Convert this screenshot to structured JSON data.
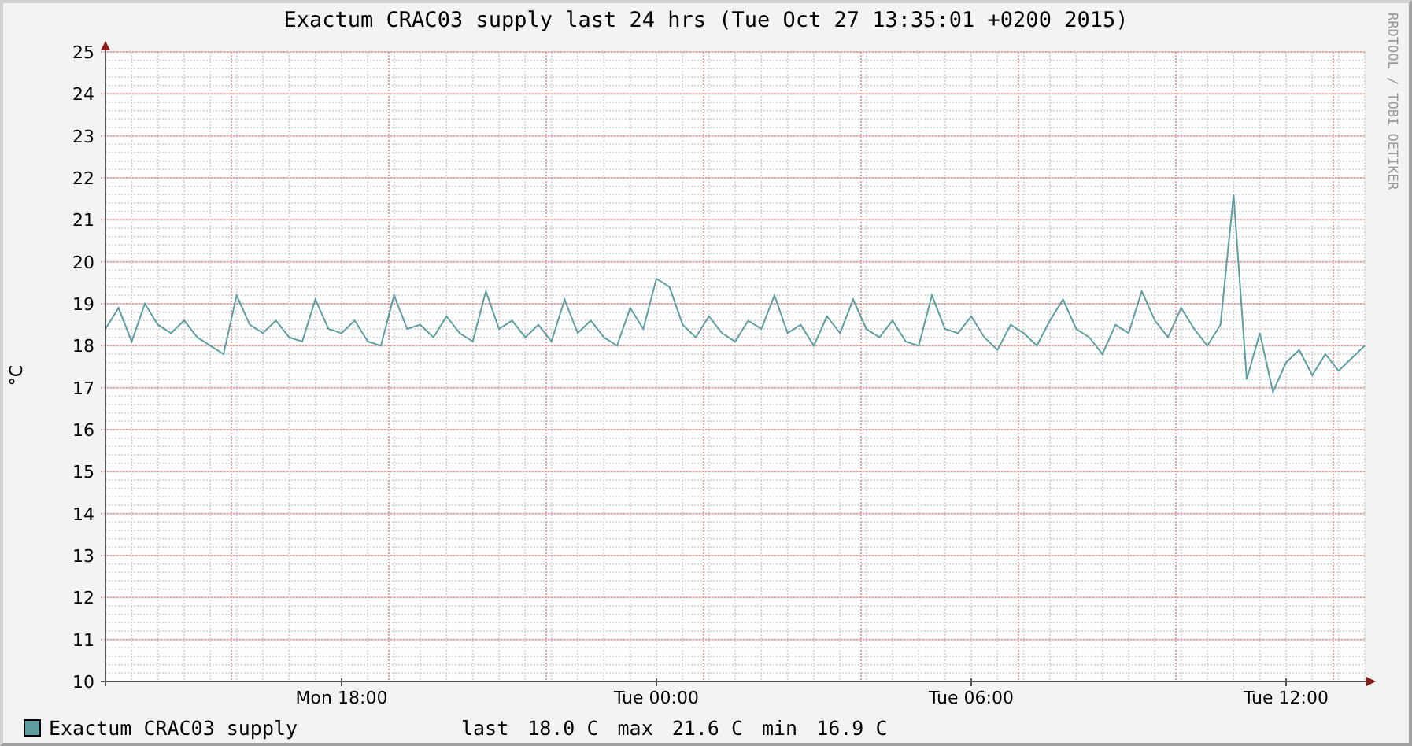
{
  "graph": {
    "credit": "RRDTOOL / TOBI OETIKER",
    "chart_data": {
      "type": "line",
      "title": "Exactum CRAC03 supply last 24 hrs (Tue Oct 27 13:35:01 +0200 2015)",
      "ylabel": "°C",
      "grid": true,
      "ylim": [
        10,
        25
      ],
      "yticks": [
        10,
        11,
        12,
        13,
        14,
        15,
        16,
        17,
        18,
        19,
        20,
        21,
        22,
        23,
        24,
        25
      ],
      "categories": [
        null,
        null,
        null,
        null,
        null,
        null,
        null,
        null,
        null,
        null,
        null,
        null,
        null,
        null,
        null,
        null,
        null,
        null,
        "Mon 18:00",
        null,
        null,
        null,
        null,
        null,
        null,
        null,
        null,
        null,
        null,
        null,
        null,
        null,
        null,
        null,
        null,
        null,
        null,
        null,
        null,
        null,
        null,
        null,
        "Tue 00:00",
        null,
        null,
        null,
        null,
        null,
        null,
        null,
        null,
        null,
        null,
        null,
        null,
        null,
        null,
        null,
        null,
        null,
        null,
        null,
        null,
        null,
        null,
        null,
        "Tue 06:00",
        null,
        null,
        null,
        null,
        null,
        null,
        null,
        null,
        null,
        null,
        null,
        null,
        null,
        null,
        null,
        null,
        null,
        null,
        null,
        null,
        null,
        null,
        null,
        "Tue 12:00",
        null,
        null,
        null,
        null,
        null,
        null
      ],
      "series": [
        {
          "name": "Exactum CRAC03 supply",
          "color": "#5f9ea0",
          "values": [
            18.4,
            18.9,
            18.1,
            19.0,
            18.5,
            18.3,
            18.6,
            18.2,
            18.0,
            17.8,
            19.2,
            18.5,
            18.3,
            18.6,
            18.2,
            18.1,
            19.1,
            18.4,
            18.3,
            18.6,
            18.1,
            18.0,
            19.2,
            18.4,
            18.5,
            18.2,
            18.7,
            18.3,
            18.1,
            19.3,
            18.4,
            18.6,
            18.2,
            18.5,
            18.1,
            19.1,
            18.3,
            18.6,
            18.2,
            18.0,
            18.9,
            18.4,
            19.6,
            19.4,
            18.5,
            18.2,
            18.7,
            18.3,
            18.1,
            18.6,
            18.4,
            19.2,
            18.3,
            18.5,
            18.0,
            18.7,
            18.3,
            19.1,
            18.4,
            18.2,
            18.6,
            18.1,
            18.0,
            19.2,
            18.4,
            18.3,
            18.7,
            18.2,
            17.9,
            18.5,
            18.3,
            18.0,
            18.6,
            19.1,
            18.4,
            18.2,
            17.8,
            18.5,
            18.3,
            19.3,
            18.6,
            18.2,
            18.9,
            18.4,
            18.0,
            18.5,
            21.6,
            17.2,
            18.3,
            16.9,
            17.6,
            17.9,
            17.3,
            17.8,
            17.4,
            17.7,
            18.0
          ]
        }
      ]
    }
  },
  "legend": {
    "stats": [
      {
        "label": "last",
        "value": "18.0 C"
      },
      {
        "label": "max",
        "value": "21.6 C"
      },
      {
        "label": "min",
        "value": "16.9 C"
      }
    ]
  }
}
